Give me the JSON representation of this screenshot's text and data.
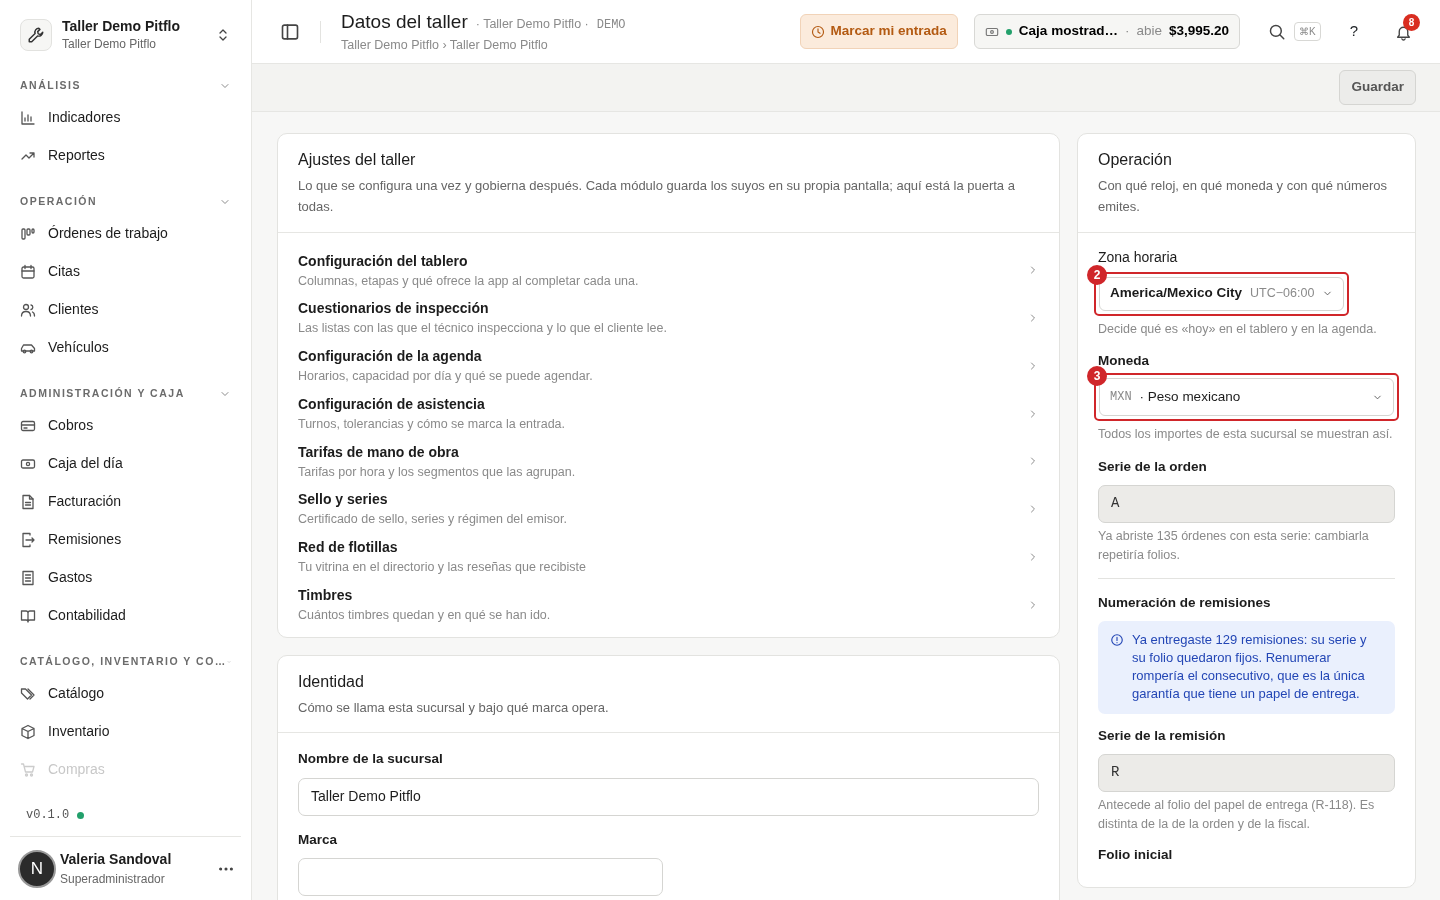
{
  "sidebar": {
    "workspace": {
      "name": "Taller Demo Pitflo",
      "subtitle": "Taller Demo Pitflo"
    },
    "sections": [
      {
        "title": "ANÁLISIS",
        "expanded": true,
        "items": [
          {
            "label": "Indicadores",
            "faded": false
          },
          {
            "label": "Reportes",
            "faded": false
          }
        ]
      },
      {
        "title": "OPERACIÓN",
        "expanded": true,
        "items": [
          {
            "label": "Órdenes de trabajo",
            "faded": false
          },
          {
            "label": "Citas",
            "faded": false
          },
          {
            "label": "Clientes",
            "faded": false
          },
          {
            "label": "Vehículos",
            "faded": false
          }
        ]
      },
      {
        "title": "ADMINISTRACIÓN Y CAJA",
        "expanded": true,
        "items": [
          {
            "label": "Cobros",
            "faded": false
          },
          {
            "label": "Caja del día",
            "faded": false
          },
          {
            "label": "Facturación",
            "faded": false
          },
          {
            "label": "Remisiones",
            "faded": false
          },
          {
            "label": "Gastos",
            "faded": false
          },
          {
            "label": "Contabilidad",
            "faded": false
          }
        ]
      },
      {
        "title": "CATÁLOGO, INVENTARIO Y CO…",
        "expanded": true,
        "items": [
          {
            "label": "Catálogo",
            "faded": false
          },
          {
            "label": "Inventario",
            "faded": false
          },
          {
            "label": "Compras",
            "faded": true
          }
        ]
      }
    ],
    "version": "v0.1.0",
    "status": {
      "color": "#22a06b"
    },
    "user": {
      "initial": "N",
      "name": "Valeria Sandoval",
      "role": "Superadministrador"
    }
  },
  "header": {
    "title": "Datos del taller",
    "context": "· Taller Demo Pitflo ·",
    "env": "DEMO",
    "breadcrumb": "Taller Demo Pitflo › Taller Demo Pitflo",
    "clock_in": "Marcar mi entrada",
    "cash": {
      "name": "Caja mostrad…",
      "separator": "·",
      "state": "abie",
      "amount": "$3,995.20",
      "status": {
        "color": "#22a06b"
      }
    },
    "shortcut": "⌘K",
    "help": "?",
    "notifications": "8"
  },
  "toolbar": {
    "save": "Guardar"
  },
  "settings_card": {
    "title": "Ajustes del taller",
    "description": "Lo que se configura una vez y gobierna después. Cada módulo guarda los suyos en su propia pantalla; aquí está la puerta a todas.",
    "links": [
      {
        "title": "Configuración del tablero",
        "description": "Columnas, etapas y qué ofrece la app al completar cada una."
      },
      {
        "title": "Cuestionarios de inspección",
        "description": "Las listas con las que el técnico inspecciona y lo que el cliente lee."
      },
      {
        "title": "Configuración de la agenda",
        "description": "Horarios, capacidad por día y qué se puede agendar."
      },
      {
        "title": "Configuración de asistencia",
        "description": "Turnos, tolerancias y cómo se marca la entrada."
      },
      {
        "title": "Tarifas de mano de obra",
        "description": "Tarifas por hora y los segmentos que las agrupan."
      },
      {
        "title": "Sello y series",
        "description": "Certificado de sello, series y régimen del emisor."
      },
      {
        "title": "Red de flotillas",
        "description": "Tu vitrina en el directorio y las reseñas que recibiste"
      },
      {
        "title": "Timbres",
        "description": "Cuántos timbres quedan y en qué se han ido."
      }
    ]
  },
  "identity_card": {
    "title": "Identidad",
    "description": "Cómo se llama esta sucursal y bajo qué marca opera.",
    "fields": [
      {
        "label": "Nombre de la sucursal",
        "value": "Taller Demo Pitflo",
        "wide": true
      },
      {
        "label": "Marca",
        "wide": false
      }
    ]
  },
  "operation_card": {
    "title": "Operación",
    "description": "Con qué reloj, en qué moneda y con qué números emites.",
    "timezone": {
      "label": "Zona horaria",
      "value": "America/Mexico City",
      "offset": "UTC−06:00",
      "hint": "Decide qué es «hoy» en el tablero y en la agenda.",
      "marker": "2"
    },
    "currency": {
      "label": "Moneda",
      "code": "MXN",
      "name": "· Peso mexicano",
      "hint": "Todos los importes de esta sucursal se muestran así.",
      "marker": "3"
    },
    "order_series": {
      "label": "Serie de la orden",
      "value": "A",
      "disabled": true,
      "hint": "Ya abriste 135 órdenes con esta serie: cambiarla repetiría folios."
    },
    "remission_heading": "Numeración de remisiones",
    "alert": "Ya entregaste 129 remisiones: su serie y su folio quedaron fijos. Renumerar rompería el consecutivo, que es la única garantía que tiene un papel de entrega.",
    "remission_series": {
      "label": "Serie de la remisión",
      "value": "R",
      "disabled": true,
      "hint": "Antecede al folio del papel de entrega (R-118). Es distinta de la de la orden y de la fiscal."
    },
    "next_label": "Folio inicial"
  }
}
